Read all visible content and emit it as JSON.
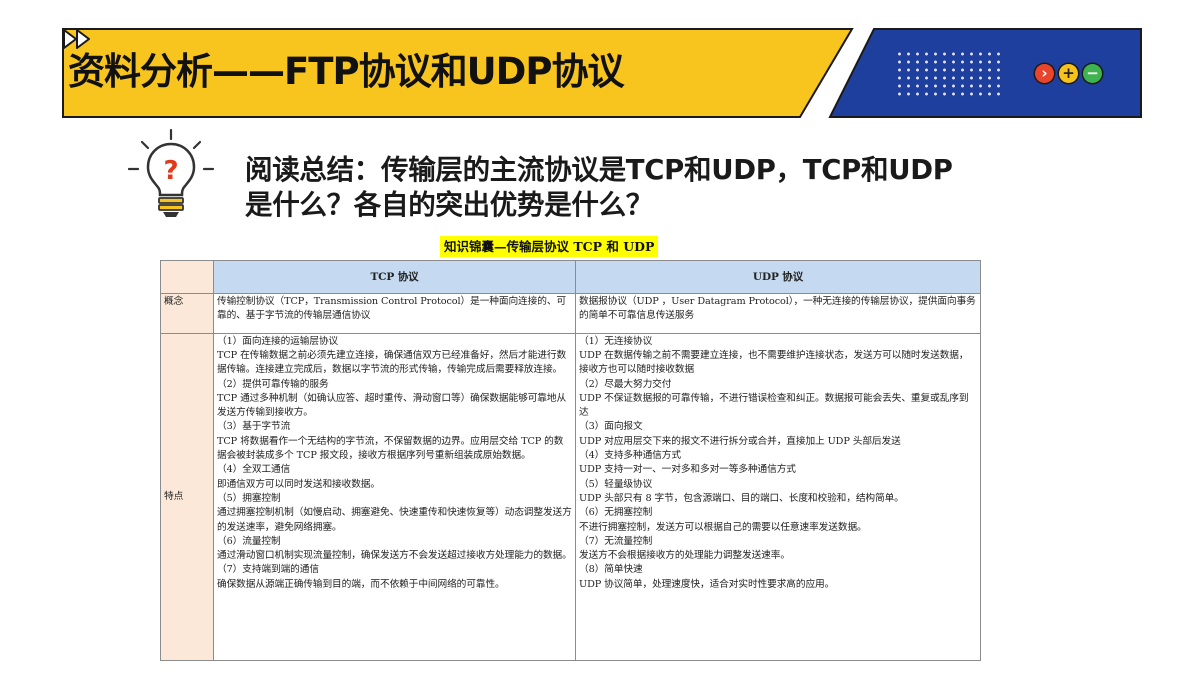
{
  "header": {
    "title": "资料分析——FTP协议和UDP协议",
    "colors": {
      "yellow": "#F8C41E",
      "blue": "#1F3F9E",
      "outline": "#1a1a1a"
    },
    "icons": [
      "fast-forward-icon",
      "previous-circle-icon",
      "plus-circle-icon",
      "minus-circle-icon"
    ],
    "circle_glyphs": {
      "prev": "›",
      "plus": "+",
      "minus": "−"
    }
  },
  "question": {
    "icon": "lightbulb-question-icon",
    "mark": "?",
    "lines": [
      "阅读总结：传输层的主流协议是TCP和UDP，TCP和UDP",
      "是什么？各自的突出优势是什么？"
    ]
  },
  "table": {
    "caption": "知识锦囊—传输层协议 TCP 和 UDP",
    "columns": [
      "",
      "TCP 协议",
      "UDP 协议"
    ],
    "rows": {
      "concept": {
        "label": "概念",
        "tcp": "传输控制协议（TCP，Transmission Control Protocol）是一种面向连接的、可靠的、基于字节流的传输层通信协议",
        "udp": "数据报协议（UDP ，User Datagram Protocol），一种无连接的传输层协议，提供面向事务的简单不可靠信息传送服务"
      },
      "features": {
        "label": "特点",
        "tcp_lines": [
          "（1）面向连接的运输层协议",
          "TCP 在传输数据之前必须先建立连接，确保通信双方已经准备好，然后才能进行数据传输。连接建立完成后，数据以字节流的形式传输，传输完成后需要释放连接。",
          "（2）提供可靠传输的服务",
          "TCP 通过多种机制（如确认应答、超时重传、滑动窗口等）确保数据能够可靠地从发送方传输到接收方。",
          "（3）基于字节流",
          "TCP 将数据看作一个无结构的字节流，不保留数据的边界。应用层交给 TCP 的数据会被封装成多个 TCP 报文段，接收方根据序列号重新组装成原始数据。",
          "（4）全双工通信",
          "即通信双方可以同时发送和接收数据。",
          "（5）拥塞控制",
          "通过拥塞控制机制（如慢启动、拥塞避免、快速重传和快速恢复等）动态调整发送方的发送速率，避免网络拥塞。",
          "（6）流量控制",
          "通过滑动窗口机制实现流量控制，确保发送方不会发送超过接收方处理能力的数据。",
          "（7）支持端到端的通信",
          "确保数据从源端正确传输到目的端，而不依赖于中间网络的可靠性。"
        ],
        "udp_lines": [
          "（1）无连接协议",
          "UDP 在数据传输之前不需要建立连接，也不需要维护连接状态，发送方可以随时发送数据，接收方也可以随时接收数据",
          "（2）尽最大努力交付",
          "UDP 不保证数据报的可靠传输，不进行错误检查和纠正。数据报可能会丢失、重复或乱序到达",
          "（3）面向报文",
          "UDP 对应用层交下来的报文不进行拆分或合并，直接加上 UDP 头部后发送",
          "（4）支持多种通信方式",
          "UDP 支持一对一、一对多和多对一等多种通信方式",
          "（5）轻量级协议",
          "UDP 头部只有 8 字节，包含源端口、目的端口、长度和校验和，结构简单。",
          "（6）无拥塞控制",
          "不进行拥塞控制，发送方可以根据自己的需要以任意速率发送数据。",
          "（7）无流量控制",
          "发送方不会根据接收方的处理能力调整发送速率。",
          "（8）简单快速",
          "UDP 协议简单，处理速度快，适合对实时性要求高的应用。"
        ]
      }
    }
  }
}
